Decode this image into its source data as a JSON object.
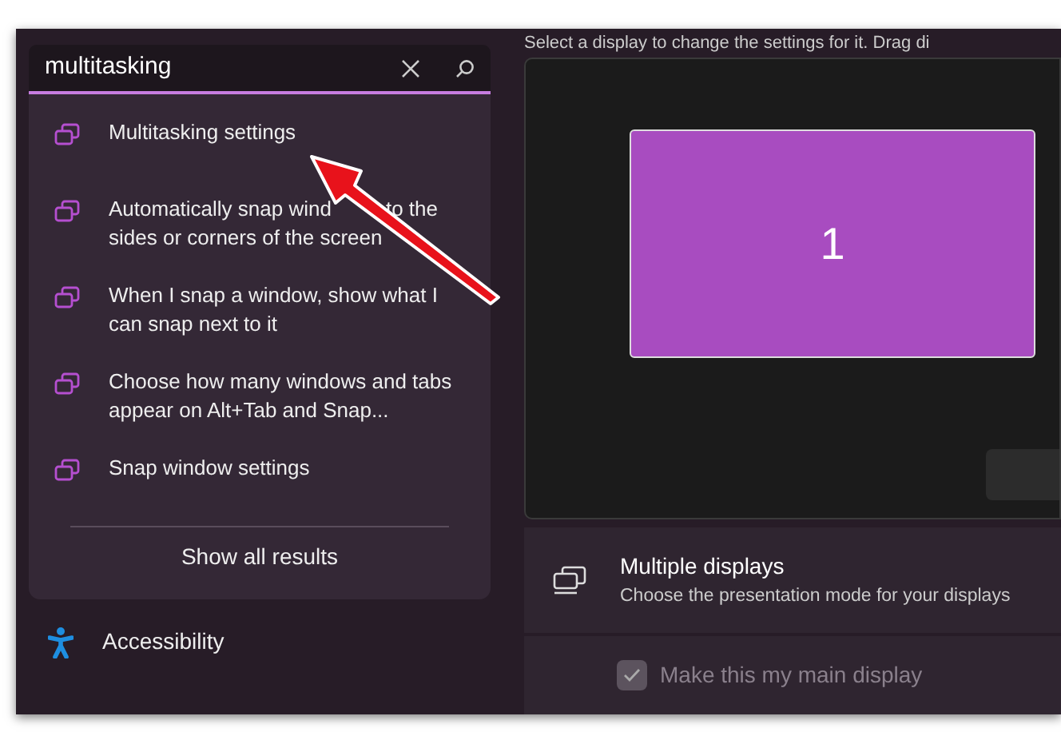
{
  "display_hint": "Select a display to change the settings for it. Drag di",
  "search": {
    "value": "multitasking"
  },
  "results": [
    {
      "label": "Multitasking settings"
    },
    {
      "label_parts": [
        "Automatically snap wind",
        "to the sides or corners of the screen"
      ]
    },
    {
      "label": "When I snap a window, show what I can snap next to it"
    },
    {
      "label": "Choose how many windows and tabs appear on Alt+Tab and Snap..."
    },
    {
      "label": "Snap window settings"
    }
  ],
  "show_all": "Show all results",
  "sidebar": {
    "items": [
      {
        "label": "Accessibility"
      }
    ]
  },
  "monitors": [
    {
      "label": "1"
    }
  ],
  "multiple_displays": {
    "title": "Multiple displays",
    "description": "Choose the presentation mode for your displays"
  },
  "main_display": {
    "label": "Make this my main display",
    "checked": true,
    "disabled": true
  }
}
